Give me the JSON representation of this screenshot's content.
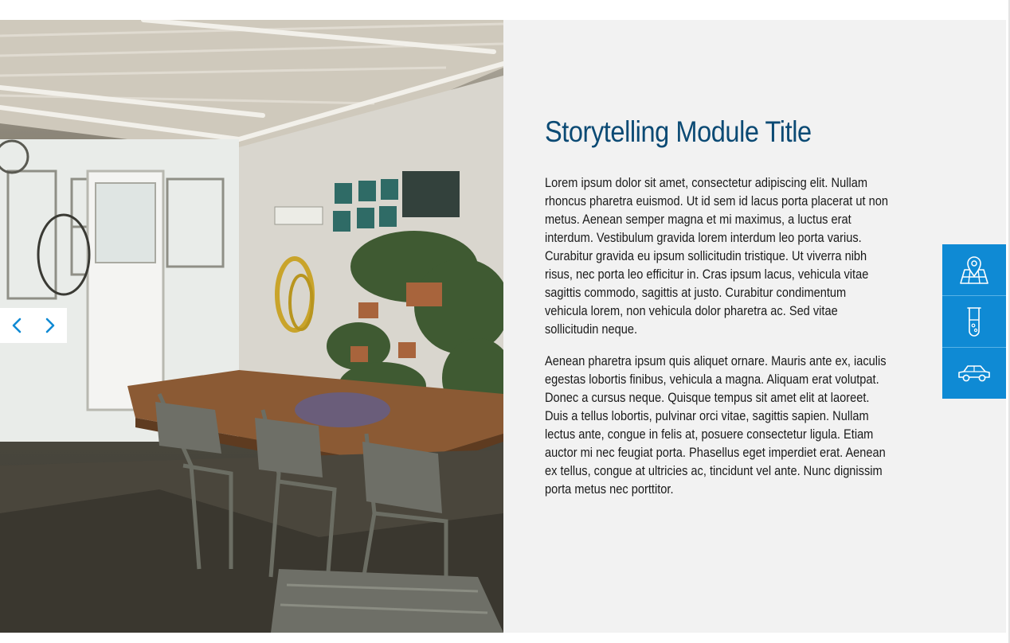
{
  "module": {
    "title": "Storytelling Module Title",
    "paragraphs": [
      "Lorem ipsum dolor sit amet, consectetur adipiscing elit. Nullam rhoncus pharetra euismod. Ut id sem id lacus porta placerat ut non metus. Aenean semper magna et mi maximus, a luctus erat interdum. Vestibulum gravida lorem interdum leo porta varius. Curabitur gravida eu ipsum sollicitudin tristique. Ut viverra nibh risus, nec porta leo efficitur in. Cras ipsum lacus, vehicula vitae sagittis commodo, sagittis at justo. Curabitur condimentum vehicula lorem, non vehicula dolor pharetra ac. Sed vitae sollicitudin neque.",
      "Aenean pharetra ipsum quis aliquet ornare. Mauris ante ex, iaculis egestas lobortis finibus, vehicula a magna. Aliquam erat volutpat. Donec a cursus neque. Quisque tempus sit amet elit at laoreet. Duis a tellus lobortis, pulvinar orci vitae, sagittis sapien. Nullam lectus ante, congue in felis at, posuere consectetur ligula. Etiam auctor mi nec feugiat porta. Phasellus eget imperdiet erat. Aenean ex tellus, congue at ultricies ac, tincidunt vel ante. Nunc dignissim porta metus nec porttitor."
    ]
  },
  "slider": {
    "prev_icon": "chevron-left-icon",
    "next_icon": "chevron-right-icon"
  },
  "side_tabs": [
    {
      "icon": "map-pin-icon"
    },
    {
      "icon": "test-tube-icon"
    },
    {
      "icon": "car-icon"
    }
  ],
  "colors": {
    "title": "#0b4a74",
    "accent": "#0f8ad4",
    "panel_background": "#f2f2f2"
  }
}
